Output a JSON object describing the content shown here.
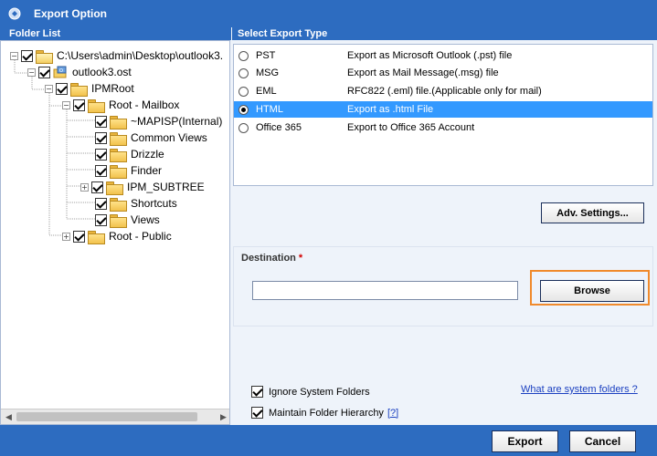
{
  "window": {
    "title": "Export Option"
  },
  "folder_list": {
    "header": "Folder List",
    "items": [
      {
        "label": "C:\\Users\\admin\\Desktop\\outlook3.",
        "expander": "−",
        "checked": true,
        "icon": "open-folder-icon"
      },
      {
        "label": "outlook3.ost",
        "expander": "−",
        "checked": true,
        "icon": "pst-file-icon"
      },
      {
        "label": "IPMRoot",
        "expander": "−",
        "checked": true,
        "icon": "folder-icon"
      },
      {
        "label": "Root - Mailbox",
        "expander": "−",
        "checked": true,
        "icon": "folder-icon"
      },
      {
        "label": "~MAPISP(Internal)",
        "expander": "",
        "checked": true,
        "icon": "folder-icon"
      },
      {
        "label": "Common Views",
        "expander": "",
        "checked": true,
        "icon": "folder-icon"
      },
      {
        "label": "Drizzle",
        "expander": "",
        "checked": true,
        "icon": "folder-icon"
      },
      {
        "label": "Finder",
        "expander": "",
        "checked": true,
        "icon": "folder-icon"
      },
      {
        "label": "IPM_SUBTREE",
        "expander": "+",
        "checked": true,
        "icon": "folder-icon"
      },
      {
        "label": "Shortcuts",
        "expander": "",
        "checked": true,
        "icon": "folder-icon"
      },
      {
        "label": "Views",
        "expander": "",
        "checked": true,
        "icon": "folder-icon"
      },
      {
        "label": "Root - Public",
        "expander": "+",
        "checked": true,
        "icon": "folder-icon"
      }
    ]
  },
  "export_type": {
    "header": "Select Export Type",
    "options": [
      {
        "name": "PST",
        "description": "Export as Microsoft Outlook (.pst) file",
        "selected": false
      },
      {
        "name": "MSG",
        "description": "Export as Mail Message(.msg) file",
        "selected": false
      },
      {
        "name": "EML",
        "description": "RFC822 (.eml) file.(Applicable only for mail)",
        "selected": false
      },
      {
        "name": "HTML",
        "description": "Export as .html File",
        "selected": true
      },
      {
        "name": "Office 365",
        "description": "Export to Office 365 Account",
        "selected": false
      }
    ],
    "adv_settings_label": "Adv. Settings..."
  },
  "destination": {
    "label": "Destination",
    "required_marker": "*",
    "value": "",
    "browse_label": "Browse"
  },
  "options": {
    "ignore_system_folders": {
      "label": "Ignore System Folders",
      "checked": true
    },
    "maintain_hierarchy": {
      "label": "Maintain Folder Hierarchy",
      "checked": true,
      "help": "[?]"
    },
    "system_folders_link": "What are system folders ?"
  },
  "footer": {
    "export_label": "Export",
    "cancel_label": "Cancel"
  },
  "colors": {
    "titlebar": "#2d6cc0",
    "selection": "#3399ff",
    "highlight_border": "#f08a2c"
  }
}
